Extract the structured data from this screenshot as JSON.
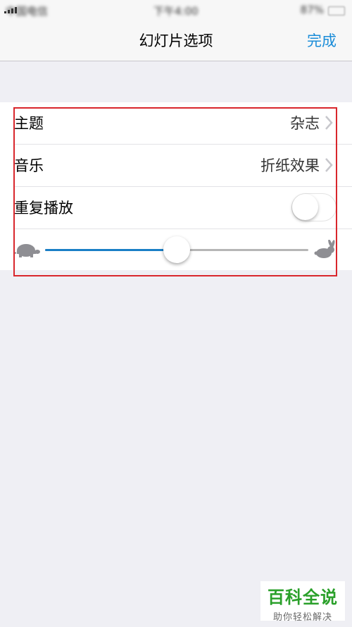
{
  "status_bar": {
    "carrier": "中国电信",
    "time": "下午4:00",
    "right": "87%"
  },
  "navbar": {
    "title": "幻灯片选项",
    "done_label": "完成"
  },
  "settings": {
    "theme": {
      "label": "主题",
      "value": "杂志"
    },
    "music": {
      "label": "音乐",
      "value": "折纸效果"
    },
    "repeat": {
      "label": "重复播放",
      "on": false
    },
    "speed": {
      "slow_icon": "turtle-icon",
      "fast_icon": "rabbit-icon",
      "value": 0.5
    }
  },
  "colors": {
    "accent": "#1a8cd8",
    "slider_fill": "#1a7fc6",
    "highlight_border": "#d9262c",
    "watermark_green": "#2aa02a"
  },
  "watermark": {
    "title": "百科全说",
    "subtitle": "助你轻松解决"
  }
}
